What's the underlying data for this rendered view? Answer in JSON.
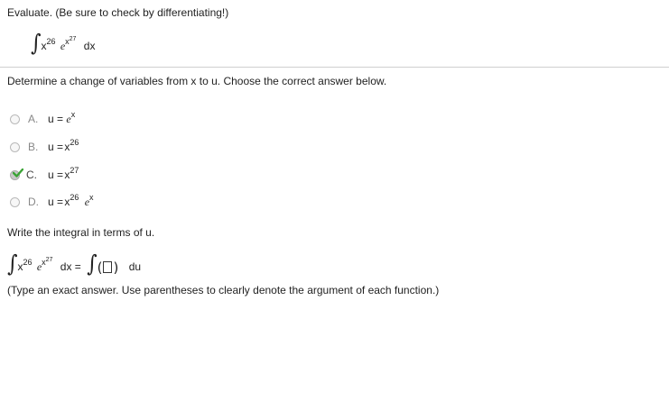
{
  "header": {
    "instruction": "Evaluate. (Be sure to check by differentiating!)"
  },
  "problem": {
    "base": "x",
    "base_exponent": "26",
    "exp_base": "e",
    "exp_inner_base": "x",
    "exp_inner_exponent": "27",
    "differential": "dx"
  },
  "part1": {
    "prompt": "Determine a change of variables from x to u. Choose the correct answer below.",
    "options": [
      {
        "letter": "A.",
        "lhs": "u =",
        "expr": "e",
        "sup": "x",
        "selected": false
      },
      {
        "letter": "B.",
        "lhs": "u =",
        "expr": "x",
        "sup": "26",
        "selected": false
      },
      {
        "letter": "C.",
        "lhs": "u =",
        "expr": "x",
        "sup": "27",
        "selected": true
      },
      {
        "letter": "D.",
        "lhs": "u =",
        "expr": "x",
        "sup": "26",
        "expr2": "e",
        "sup2": "x",
        "selected": false
      }
    ]
  },
  "part2": {
    "prompt": "Write the integral in terms of u.",
    "equals": "dx =",
    "du": "du",
    "hint": "(Type an exact answer. Use parentheses to clearly denote the argument of each function.)"
  },
  "colors": {
    "divider": "#cfcfcf",
    "check_green": "#3aa335",
    "option_label": "#888888"
  },
  "icons": {
    "correct": "check-icon",
    "radio": "radio-circle"
  }
}
